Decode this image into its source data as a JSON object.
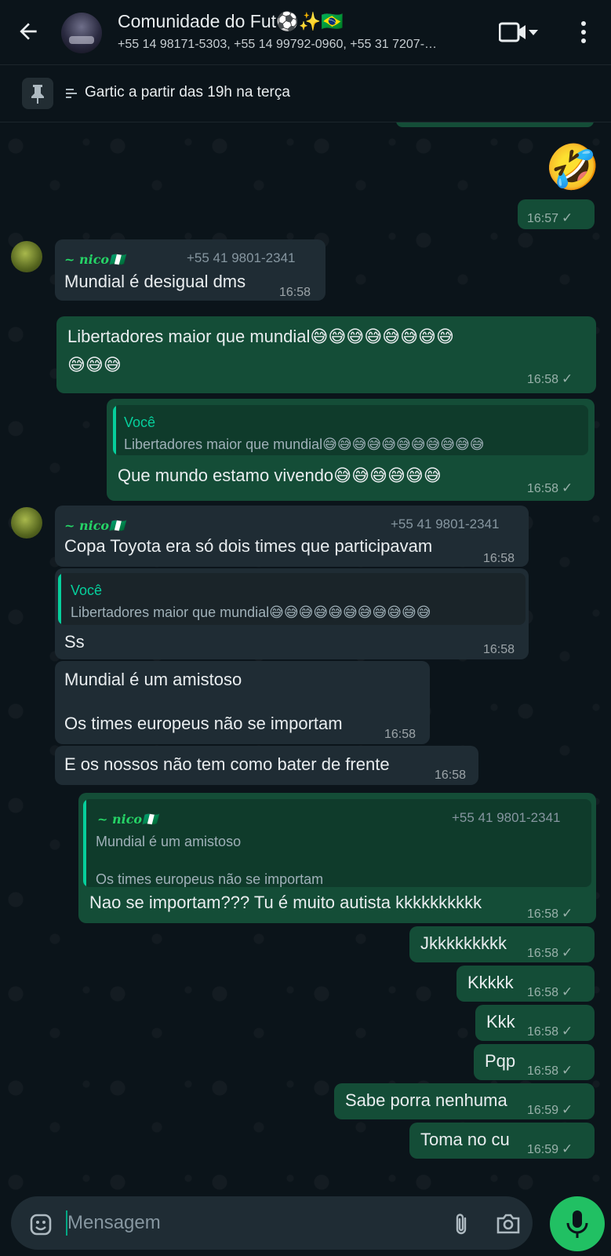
{
  "header": {
    "title": "Comunidade do Fut⚽✨🇧🇷",
    "subtitle": "+55 14 98171-5303, +55 14 99792-0960, +55 31 7207-…",
    "icons": [
      "back-arrow-icon",
      "group-avatar",
      "video-call-icon",
      "chevron-down-icon",
      "more-options-icon"
    ]
  },
  "pinned": {
    "text": "Gartic a partir das 19h na terça",
    "icon": "pin-icon"
  },
  "messages": [
    {
      "emoji": "🤣",
      "time": "16:57",
      "check": "✓"
    },
    {
      "sender": "~ nico🇳🇬",
      "phone": "+55 41 9801-2341",
      "text": "Mundial é desigual dms",
      "time": "16:58"
    },
    {
      "text1": "Libertadores maior que mundial😅😅😅😅😅😅😅😅",
      "text2": "😅😅😅",
      "time": "16:58",
      "check": "✓"
    },
    {
      "quote_name": "Você",
      "quote_text": "Libertadores maior que mundial😅😅😅😅😅😅😅😅😅😅😅",
      "text": "Que mundo estamo vivendo😅😅😅😅😅😅",
      "time": "16:58",
      "check": "✓"
    },
    {
      "sender": "~ nico🇳🇬",
      "phone": "+55 41 9801-2341",
      "text": "Copa Toyota era só dois times que participavam",
      "time": "16:58"
    },
    {
      "quote_name": "Você",
      "quote_text": "Libertadores maior que mundial😅😅😅😅😅😅😅😅😅😅😅",
      "text": "Ss",
      "time": "16:58"
    },
    {
      "text1": "Mundial é um amistoso",
      "text2": "Os times europeus não se importam",
      "time": "16:58"
    },
    {
      "text": "E os nossos não tem como bater de frente",
      "time": "16:58"
    },
    {
      "quote_name": "~ nico🇳🇬",
      "quote_phone": "+55 41 9801-2341",
      "quote_text1": "Mundial é um amistoso",
      "quote_text2": "Os times europeus não se importam",
      "text": "Nao se importam??? Tu é muito autista kkkkkkkkkk",
      "time": "16:58",
      "check": "✓"
    },
    {
      "text": "Jkkkkkkkkk",
      "time": "16:58",
      "check": "✓"
    },
    {
      "text": "Kkkkk",
      "time": "16:58",
      "check": "✓"
    },
    {
      "text": "Kkk",
      "time": "16:58",
      "check": "✓"
    },
    {
      "text": "Pqp",
      "time": "16:58",
      "check": "✓"
    },
    {
      "text": "Sabe porra nenhuma",
      "time": "16:59",
      "check": "✓"
    },
    {
      "text": "Toma no cu",
      "time": "16:59",
      "check": "✓"
    }
  ],
  "input": {
    "placeholder": "Mensagem",
    "icons": [
      "emoji-icon",
      "attach-icon",
      "camera-icon",
      "mic-icon"
    ]
  },
  "colors": {
    "outgoing": "#144d37",
    "incoming": "#1f2c34",
    "accent": "#25d366",
    "background": "#0b141a"
  }
}
